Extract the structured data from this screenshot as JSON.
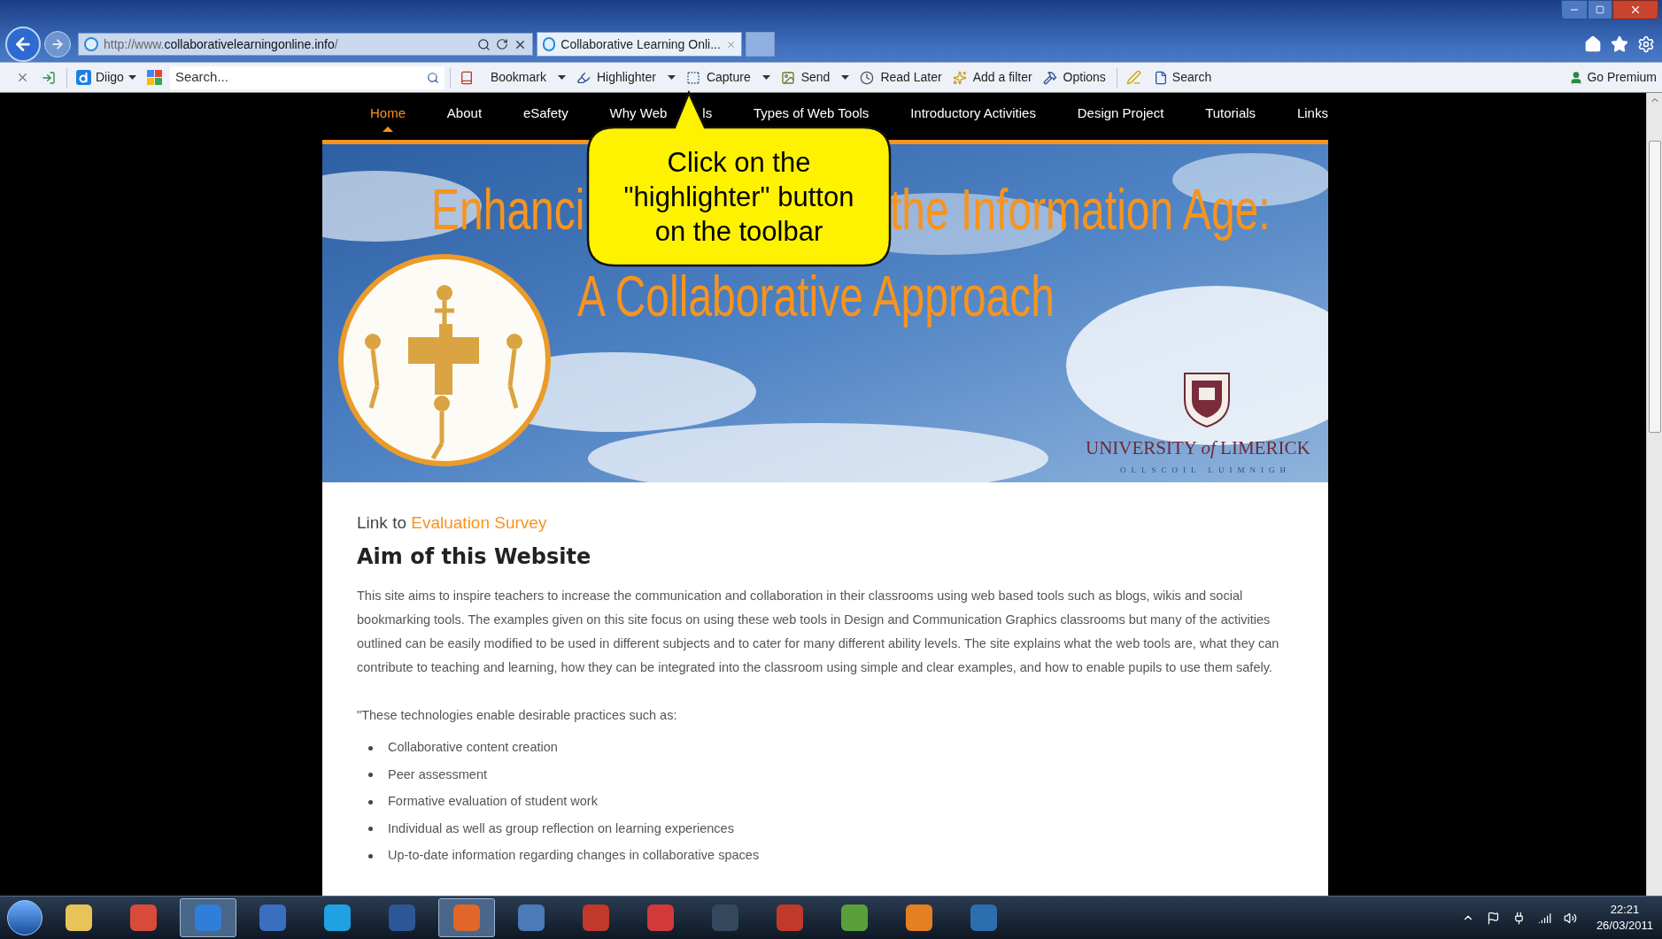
{
  "browser": {
    "address": {
      "url_prefix": "http://www.",
      "url_domain": "collaborativelearningonline.info",
      "url_suffix": "/"
    },
    "tab": {
      "title": "Collaborative Learning Onli...",
      "selected": true
    },
    "toolbar": {
      "diigo_label": "Diigo",
      "search_placeholder": "Search...",
      "items": [
        {
          "label": "Bookmark",
          "dropdown": true
        },
        {
          "label": "Highlighter",
          "dropdown": true
        },
        {
          "label": "Capture",
          "dropdown": true
        },
        {
          "label": "Send",
          "dropdown": true
        },
        {
          "label": "Read Later",
          "dropdown": false
        },
        {
          "label": "Add a filter",
          "dropdown": false
        },
        {
          "label": "Options",
          "dropdown": false
        }
      ],
      "search_label": "Search",
      "premium_label": "Go Premium"
    }
  },
  "site": {
    "nav": [
      {
        "label": "Home",
        "selected": true
      },
      {
        "label": "About",
        "selected": false
      },
      {
        "label": "eSafety",
        "selected": false
      },
      {
        "label": "Why Web",
        "label_tail": "ls",
        "selected": false
      },
      {
        "label": "Types of Web Tools",
        "selected": false
      },
      {
        "label": "Introductory Activities",
        "selected": false
      },
      {
        "label": "Design Project",
        "selected": false
      },
      {
        "label": "Tutorials",
        "selected": false
      },
      {
        "label": "Links",
        "selected": false
      }
    ],
    "banner": {
      "headline_start": "Enhanci",
      "headline_end": "the Information Age:",
      "headline_line2": "A Collaborative Approach",
      "university": "UNIVERSITY *of* LIMERICK",
      "university_irish": "OLLSCOIL LUIMNIGH"
    },
    "content": {
      "link_prefix": "Link to",
      "link_text": "Evaluation Survey",
      "heading": "Aim of this Website",
      "paragraph": "This site aims to inspire teachers to increase the communication and collaboration in their classrooms using web based tools such as blogs, wikis and social bookmarking tools. The examples given on this site focus on using these web tools in Design and Communication Graphics classrooms but many of the activities outlined can be easily modified to be used in different subjects and to cater for many different ability levels. The site explains what the web tools are, what they can contribute to teaching and learning, how they can be integrated into the classroom using simple and clear examples, and how to enable pupils to use them safely.",
      "intro": "\"These technologies enable desirable practices such as:",
      "bullets": [
        "Collaborative content creation",
        "Peer assessment",
        "Formative evaluation of student work",
        "Individual as well as group reflection on learning experiences",
        "Up-to-date information regarding changes in collaborative spaces"
      ]
    }
  },
  "callout": {
    "lines": [
      "Click on the",
      "\"highlighter\" button",
      "on the toolbar"
    ]
  },
  "taskbar": {
    "apps": [
      {
        "active": false
      },
      {
        "active": false
      },
      {
        "active": true
      },
      {
        "active": false
      },
      {
        "active": false
      },
      {
        "active": false
      },
      {
        "active": true
      },
      {
        "active": false
      },
      {
        "active": false
      },
      {
        "active": false
      },
      {
        "active": false
      },
      {
        "active": false
      },
      {
        "active": false
      },
      {
        "active": false
      },
      {
        "active": false
      }
    ],
    "time": "22:21",
    "date": "26/03/2011"
  }
}
